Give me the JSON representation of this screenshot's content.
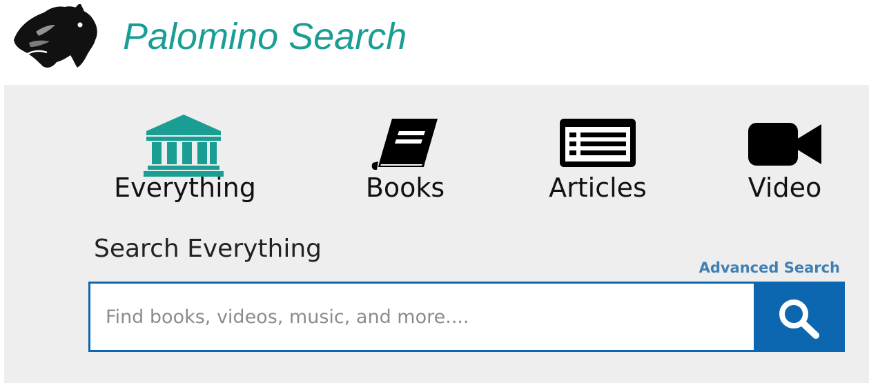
{
  "brand": {
    "title": "Palomino Search",
    "logo_icon": "horse-head-icon",
    "title_color": "#1a9e93"
  },
  "tabs": [
    {
      "label": "Everything",
      "icon": "library-icon",
      "icon_color": "#1a9e93"
    },
    {
      "label": "Books",
      "icon": "book-icon",
      "icon_color": "#000000"
    },
    {
      "label": "Articles",
      "icon": "newspaper-icon",
      "icon_color": "#000000"
    },
    {
      "label": "Video",
      "icon": "video-camera-icon",
      "icon_color": "#000000"
    }
  ],
  "search": {
    "heading": "Search Everything",
    "advanced_link": "Advanced Search",
    "placeholder": "Find books, videos, music, and more....",
    "value": "",
    "button_icon": "search-icon",
    "accent_color": "#0d67b0"
  }
}
